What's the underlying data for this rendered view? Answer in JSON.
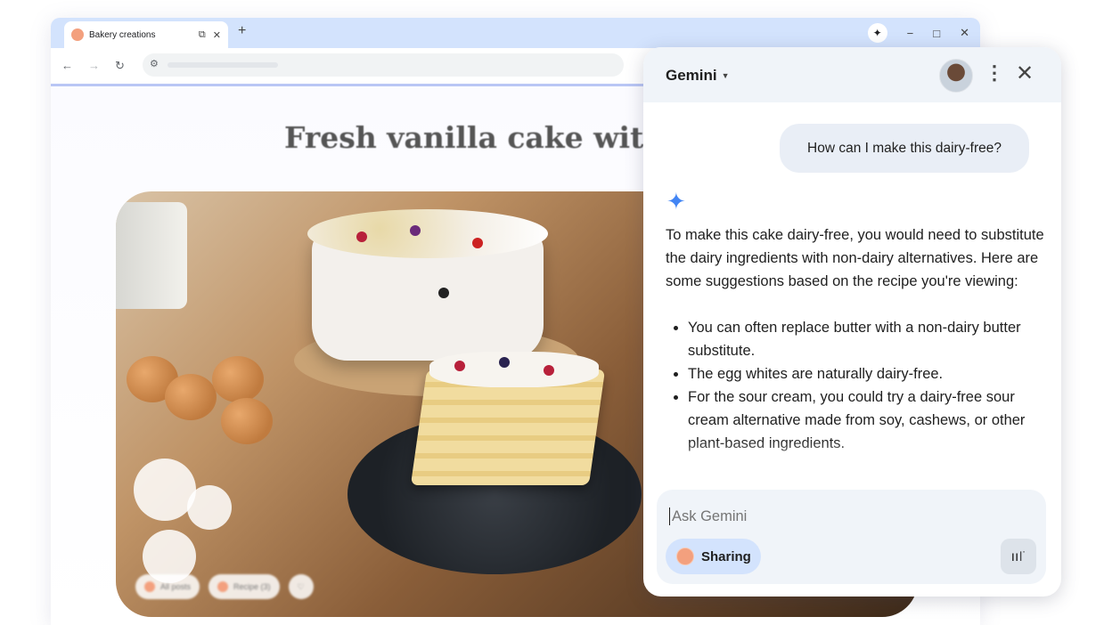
{
  "browser": {
    "tab_title": "Bakery creations",
    "new_tab": "+",
    "window_controls": {
      "minimize": "−",
      "maximize": "□",
      "close": "✕"
    }
  },
  "page": {
    "title": "Fresh vanilla cake with l",
    "chips": [
      "All posts",
      "Recipe (3)"
    ]
  },
  "gemini": {
    "title": "Gemini",
    "user_message": "How can I make this dairy-free?",
    "response_intro": "To make this cake dairy-free, you would need to substitute the dairy ingredients with non-dairy alternatives. Here are some suggestions based on the recipe you're viewing:",
    "response_items": [
      "You can often replace butter with a non-dairy butter substitute.",
      "The egg whites are naturally dairy-free.",
      "For the sour cream, you could try a dairy-free sour cream alternative made from soy, cashews, or other plant-based ingredients."
    ],
    "input_placeholder": "Ask Gemini",
    "sharing_label": "Sharing"
  },
  "icons": {
    "gemini_spark": "spark-icon",
    "tab_share": "share-icon",
    "tab_close": "close-icon",
    "back": "back-arrow-icon",
    "forward": "forward-arrow-icon",
    "reload": "reload-icon",
    "site_settings": "tune-icon",
    "more": "more-vert-icon",
    "panel_close": "close-icon",
    "voice": "voice-wave-icon"
  },
  "colors": {
    "tabstrip": "#d3e3fd",
    "gemini_spark": "#4285f4",
    "sharing_chip": "#d3e3fd",
    "panel_header": "#f0f4f9"
  }
}
